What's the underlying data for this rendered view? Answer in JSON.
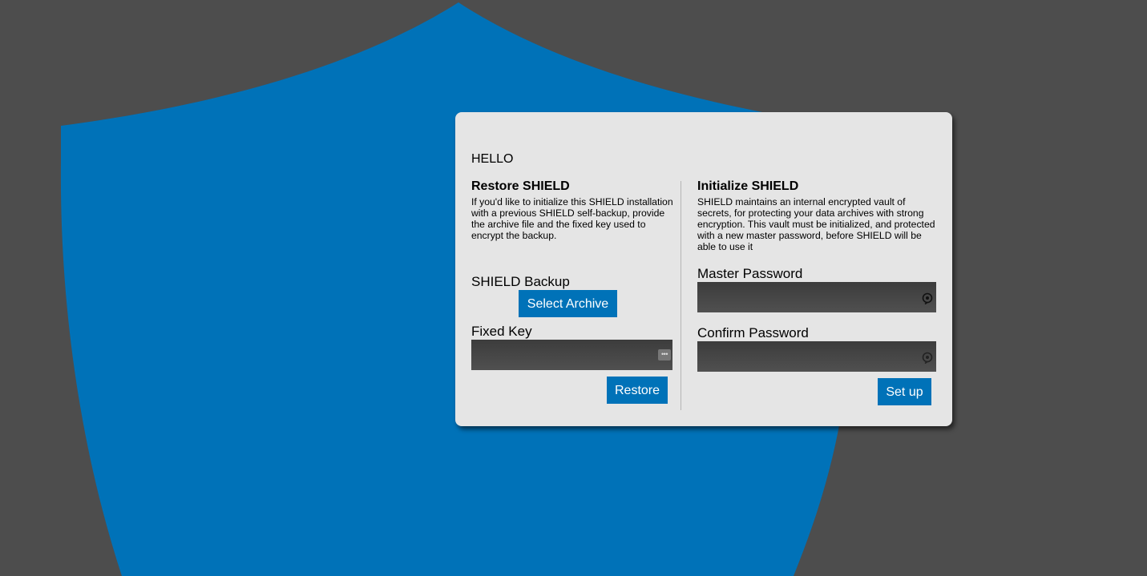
{
  "colors": {
    "background": "#4d4d4d",
    "shield": "#0072b8",
    "panel": "#e5e5e5",
    "button": "#0072b8",
    "input": "#444444"
  },
  "greeting": "HELLO",
  "restore": {
    "title": "Restore SHIELD",
    "description": "If you'd like to initialize this SHIELD installation with a previous SHIELD self-backup, provide the archive file and the fixed key used to encrypt the backup.",
    "backup_label": "SHIELD Backup",
    "select_archive_label": "Select Archive",
    "fixed_key_label": "Fixed Key",
    "fixed_key_value": "",
    "fixed_key_icon": "more-dots-icon",
    "restore_label": "Restore"
  },
  "initialize": {
    "title": "Initialize SHIELD",
    "description": "SHIELD maintains an internal encrypted vault of secrets, for protecting your data archives with strong encryption. This vault must be initialized, and protected with a new master password, before SHIELD will be able to use it",
    "master_password_label": "Master Password",
    "master_password_value": "",
    "confirm_password_label": "Confirm Password",
    "confirm_password_value": "",
    "password_icon": "reveal-password-icon",
    "setup_label": "Set up"
  }
}
